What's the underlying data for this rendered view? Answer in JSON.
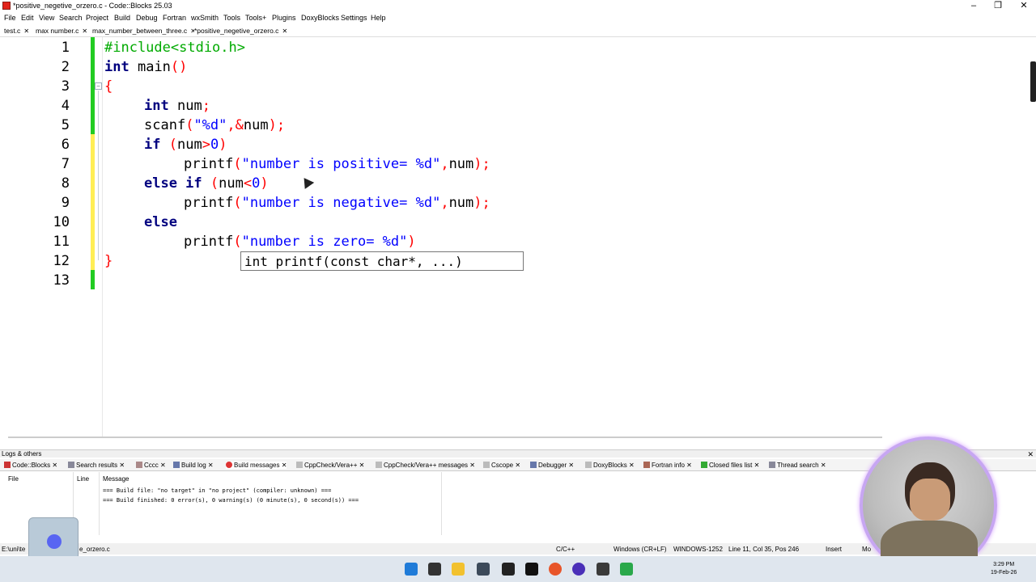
{
  "window": {
    "title": "*positive_negetive_orzero.c - Code::Blocks 25.03"
  },
  "menu": [
    "File",
    "Edit",
    "View",
    "Search",
    "Project",
    "Build",
    "Debug",
    "Fortran",
    "wxSmith",
    "Tools",
    "Tools+",
    "Plugins",
    "DoxyBlocks",
    "Settings",
    "Help"
  ],
  "tabs": [
    {
      "label": "test.c"
    },
    {
      "label": "max number.c"
    },
    {
      "label": "max_number_between_three.c"
    },
    {
      "label": "*positive_negetive_orzero.c"
    }
  ],
  "editor": {
    "line_numbers": [
      "1",
      "2",
      "3",
      "4",
      "5",
      "6",
      "7",
      "8",
      "9",
      "10",
      "11",
      "12",
      "13"
    ],
    "tooltip": "int printf(const char*, ...)"
  },
  "logs": {
    "title": "Logs & others",
    "tabs": [
      "Code::Blocks",
      "Search results",
      "Cccc",
      "Build log",
      "Build messages",
      "CppCheck/Vera++",
      "CppCheck/Vera++ messages",
      "Cscope",
      "Debugger",
      "DoxyBlocks",
      "Fortran info",
      "Closed files list",
      "Thread search"
    ],
    "columns": {
      "file": "File",
      "line": "Line",
      "message": "Message"
    },
    "messages": [
      "=== Build file: \"no target\" in \"no project\" (compiler: unknown) ===",
      "=== Build finished: 0 error(s), 0 warning(s) (0 minute(s), 0 second(s)) ==="
    ]
  },
  "status": {
    "path": "E:\\uni\\te",
    "path_tail": "e_orzero.c",
    "language": "C/C++",
    "line_endings": "Windows (CR+LF)",
    "encoding": "WINDOWS-1252",
    "position": "Line 11, Col 35, Pos 246",
    "mode": "Insert",
    "extra": "Mo"
  },
  "taskbar": {
    "time": "3:29 PM",
    "date": "19-Feb-26"
  },
  "colors": {
    "keyword": "#00007f",
    "preprocessor": "#00aa00",
    "string": "#0000ff",
    "operator": "#ff0000",
    "saved_bar": "#22cc22",
    "modified_bar": "#ffee55"
  }
}
